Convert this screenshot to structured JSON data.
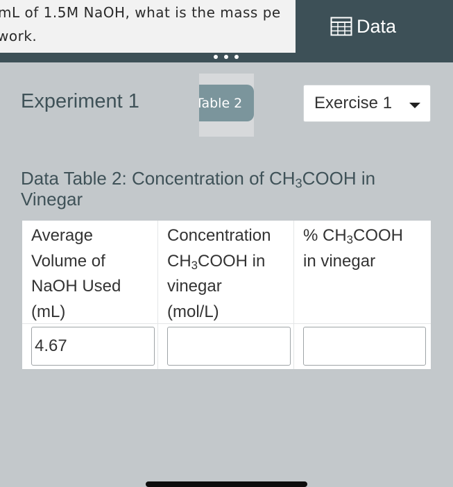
{
  "question": {
    "line1": "mL of 1.5M NaOH, what is the mass pe",
    "line2": "work."
  },
  "header": {
    "data_button_label": "Data",
    "data_button_icon": "table-grid-icon",
    "bar_color": "#3d5057"
  },
  "experiment_title": "Experiment 1",
  "tab": {
    "label": "Table 2"
  },
  "exercise_select": {
    "value": "Exercise 1"
  },
  "data_table": {
    "title": "Data Table 2: Concentration of CH3COOH in Vinegar",
    "headers": [
      [
        "Average",
        "Volume of",
        "NaOH Used",
        "(mL)"
      ],
      [
        "Concentration",
        "CH3COOH in",
        "vinegar",
        "(mol/L)"
      ],
      [
        "% CH3COOH",
        "in vinegar"
      ]
    ],
    "inputs": [
      "4.67",
      "",
      ""
    ]
  }
}
